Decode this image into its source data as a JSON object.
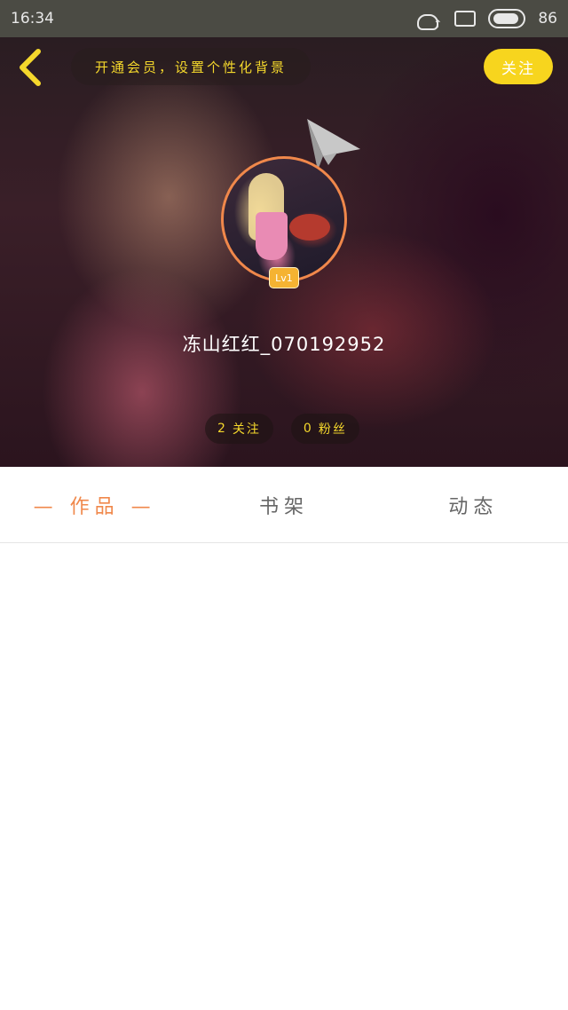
{
  "status_bar": {
    "time": "16:34",
    "battery_level": "86",
    "icons": [
      "notification-icon",
      "screen-icon",
      "battery-icon"
    ]
  },
  "header": {
    "vip_banner": "开通会员，设置个性化背景",
    "follow_label": "关注"
  },
  "profile": {
    "level": "Lv1",
    "username": "冻山红红_070192952",
    "following_count": "2",
    "following_label": "关注",
    "fans_count": "0",
    "fans_label": "粉丝"
  },
  "tabs": [
    {
      "label": "— 作品 —",
      "active": true
    },
    {
      "label": "书架",
      "active": false
    },
    {
      "label": "动态",
      "active": false
    }
  ],
  "colors": {
    "accent_yellow": "#f5d82c",
    "accent_orange": "#f0884b",
    "status_bar_bg": "#4b4b44"
  }
}
